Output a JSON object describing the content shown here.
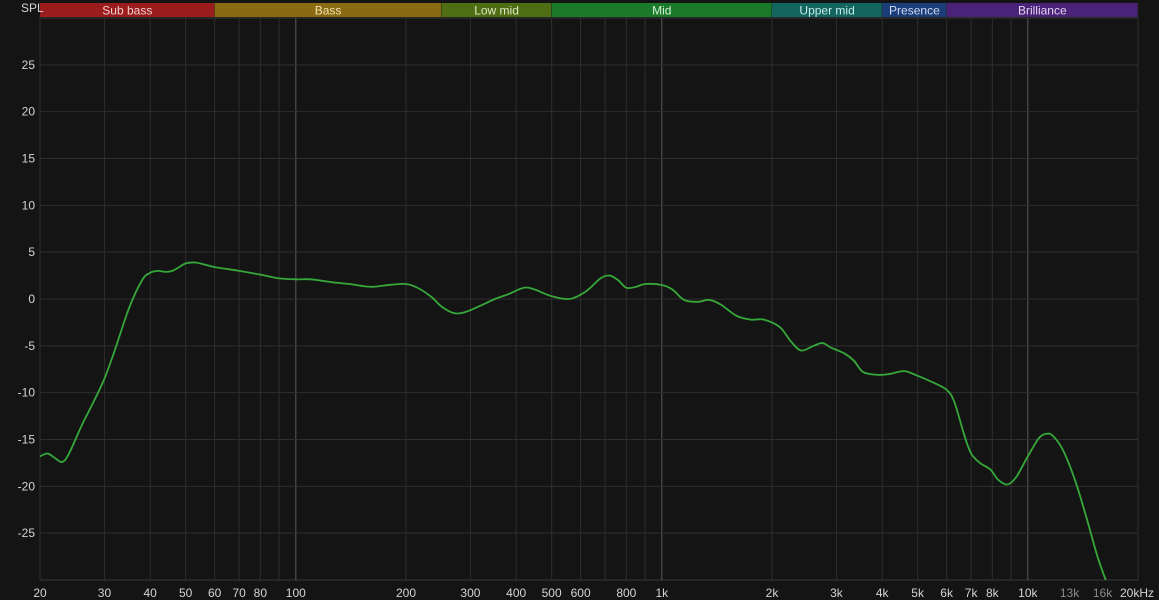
{
  "chart_data": {
    "type": "line",
    "ylabel": "SPL",
    "x_scale": "log",
    "xlim": [
      20,
      20000
    ],
    "ylim": [
      -30,
      30
    ],
    "grid": true,
    "y_ticks": [
      -25,
      -20,
      -15,
      -10,
      -5,
      0,
      5,
      10,
      15,
      20,
      25
    ],
    "x_ticks": [
      {
        "value": 20,
        "label": "20"
      },
      {
        "value": 30,
        "label": "30"
      },
      {
        "value": 40,
        "label": "40"
      },
      {
        "value": 50,
        "label": "50"
      },
      {
        "value": 60,
        "label": "60"
      },
      {
        "value": 70,
        "label": "70"
      },
      {
        "value": 80,
        "label": "80"
      },
      {
        "value": 100,
        "label": "100"
      },
      {
        "value": 200,
        "label": "200"
      },
      {
        "value": 300,
        "label": "300"
      },
      {
        "value": 400,
        "label": "400"
      },
      {
        "value": 500,
        "label": "500"
      },
      {
        "value": 600,
        "label": "600"
      },
      {
        "value": 800,
        "label": "800"
      },
      {
        "value": 1000,
        "label": "1k"
      },
      {
        "value": 2000,
        "label": "2k"
      },
      {
        "value": 3000,
        "label": "3k"
      },
      {
        "value": 4000,
        "label": "4k"
      },
      {
        "value": 5000,
        "label": "5k"
      },
      {
        "value": 6000,
        "label": "6k"
      },
      {
        "value": 7000,
        "label": "7k"
      },
      {
        "value": 8000,
        "label": "8k"
      },
      {
        "value": 10000,
        "label": "10k"
      },
      {
        "value": 13000,
        "label": "13k",
        "dim": true
      },
      {
        "value": 16000,
        "label": "16k",
        "dim": true
      },
      {
        "value": 20000,
        "label": "20kHz"
      }
    ],
    "bands": [
      {
        "name": "Sub bass",
        "from": 20,
        "to": 60,
        "color": "#9b1c1c",
        "text": "#f0d0d0"
      },
      {
        "name": "Bass",
        "from": 60,
        "to": 250,
        "color": "#8a6a12",
        "text": "#f2e2b0"
      },
      {
        "name": "Low mid",
        "from": 250,
        "to": 500,
        "color": "#4f6e14",
        "text": "#dfe9c4"
      },
      {
        "name": "Mid",
        "from": 500,
        "to": 2000,
        "color": "#1b7a2a",
        "text": "#d4f0d4"
      },
      {
        "name": "Upper mid",
        "from": 2000,
        "to": 4000,
        "color": "#136560",
        "text": "#c8ecea"
      },
      {
        "name": "Presence",
        "from": 4000,
        "to": 6000,
        "color": "#1b3d78",
        "text": "#cfdaf2"
      },
      {
        "name": "Brilliance",
        "from": 6000,
        "to": 20000,
        "color": "#4a2378",
        "text": "#e2d4f2"
      }
    ],
    "series": [
      {
        "color": "#36a83a",
        "points": [
          [
            20,
            -16.8
          ],
          [
            21,
            -16.5
          ],
          [
            22,
            -17
          ],
          [
            23,
            -17.4
          ],
          [
            24,
            -16.5
          ],
          [
            26,
            -13.5
          ],
          [
            28,
            -11
          ],
          [
            30,
            -8.5
          ],
          [
            32,
            -5.5
          ],
          [
            35,
            -1
          ],
          [
            38,
            2
          ],
          [
            40,
            2.8
          ],
          [
            42,
            3
          ],
          [
            44,
            2.9
          ],
          [
            46,
            3.0
          ],
          [
            48,
            3.4
          ],
          [
            50,
            3.8
          ],
          [
            53,
            3.9
          ],
          [
            56,
            3.7
          ],
          [
            60,
            3.4
          ],
          [
            65,
            3.2
          ],
          [
            70,
            3.0
          ],
          [
            80,
            2.6
          ],
          [
            90,
            2.2
          ],
          [
            100,
            2.1
          ],
          [
            110,
            2.1
          ],
          [
            125,
            1.8
          ],
          [
            140,
            1.6
          ],
          [
            160,
            1.3
          ],
          [
            180,
            1.5
          ],
          [
            200,
            1.6
          ],
          [
            215,
            1.2
          ],
          [
            235,
            0.2
          ],
          [
            250,
            -0.8
          ],
          [
            270,
            -1.5
          ],
          [
            290,
            -1.4
          ],
          [
            320,
            -0.7
          ],
          [
            350,
            0
          ],
          [
            380,
            0.5
          ],
          [
            420,
            1.2
          ],
          [
            450,
            1.0
          ],
          [
            500,
            0.3
          ],
          [
            560,
            0
          ],
          [
            620,
            0.8
          ],
          [
            680,
            2.2
          ],
          [
            720,
            2.5
          ],
          [
            760,
            2.0
          ],
          [
            800,
            1.2
          ],
          [
            850,
            1.3
          ],
          [
            900,
            1.6
          ],
          [
            1000,
            1.5
          ],
          [
            1070,
            1.0
          ],
          [
            1150,
            -0.1
          ],
          [
            1250,
            -0.3
          ],
          [
            1350,
            -0.1
          ],
          [
            1450,
            -0.6
          ],
          [
            1600,
            -1.8
          ],
          [
            1750,
            -2.2
          ],
          [
            1900,
            -2.2
          ],
          [
            2100,
            -3.0
          ],
          [
            2250,
            -4.5
          ],
          [
            2400,
            -5.5
          ],
          [
            2600,
            -5.0
          ],
          [
            2750,
            -4.7
          ],
          [
            2900,
            -5.2
          ],
          [
            3150,
            -5.8
          ],
          [
            3350,
            -6.6
          ],
          [
            3550,
            -7.8
          ],
          [
            3900,
            -8.1
          ],
          [
            4200,
            -8.0
          ],
          [
            4600,
            -7.7
          ],
          [
            5000,
            -8.2
          ],
          [
            5500,
            -8.9
          ],
          [
            6000,
            -9.7
          ],
          [
            6300,
            -11
          ],
          [
            6700,
            -14.5
          ],
          [
            7000,
            -16.5
          ],
          [
            7400,
            -17.5
          ],
          [
            7900,
            -18.2
          ],
          [
            8300,
            -19.3
          ],
          [
            8800,
            -19.8
          ],
          [
            9300,
            -19
          ],
          [
            10000,
            -16.8
          ],
          [
            10700,
            -14.9
          ],
          [
            11200,
            -14.4
          ],
          [
            11700,
            -14.6
          ],
          [
            12500,
            -16.2
          ],
          [
            13500,
            -19.5
          ],
          [
            14500,
            -23.5
          ],
          [
            15500,
            -27.5
          ],
          [
            16500,
            -30.5
          ]
        ]
      }
    ]
  }
}
